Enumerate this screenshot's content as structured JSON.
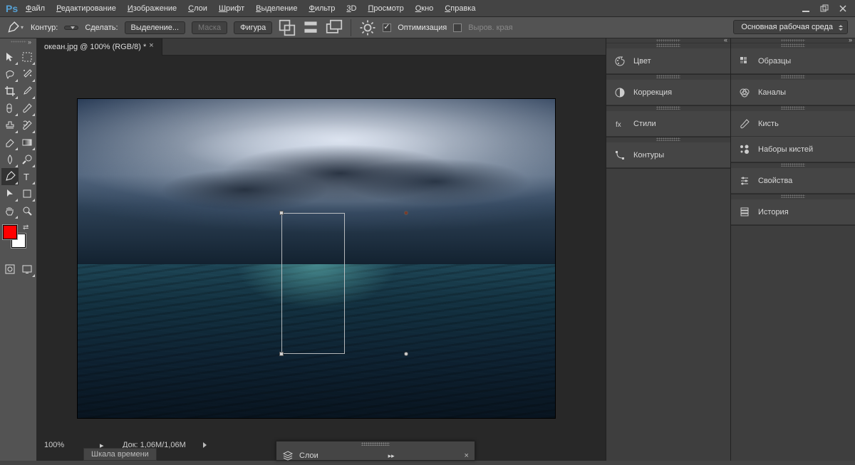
{
  "menubar": {
    "items": [
      "Файл",
      "Редактирование",
      "Изображение",
      "Слои",
      "Шрифт",
      "Выделение",
      "Фильтр",
      "3D",
      "Просмотр",
      "Окно",
      "Справка"
    ]
  },
  "options": {
    "contour_label": "Контур:",
    "make_label": "Сделать:",
    "selection_btn": "Выделение...",
    "mask_btn": "Маска",
    "shape_btn": "Фигура",
    "optimize_label": "Оптимизация",
    "align_edges_label": "Выров. края",
    "workspace": "Основная рабочая среда"
  },
  "document": {
    "tab_title": "океан.jpg @ 100% (RGB/8) *"
  },
  "status": {
    "zoom": "100%",
    "doc_info": "Док: 1,06M/1,06M"
  },
  "timeline": {
    "label": "Шкала времени"
  },
  "layers_panel": {
    "title": "Слои"
  },
  "panels_left": {
    "color": "Цвет",
    "correction": "Коррекция",
    "styles": "Стили",
    "contours": "Контуры"
  },
  "panels_right": {
    "swatches": "Образцы",
    "channels": "Каналы",
    "brush": "Кисть",
    "brush_sets": "Наборы кистей",
    "properties": "Свойства",
    "history": "История"
  },
  "colors": {
    "foreground": "#ff0000",
    "background": "#ffffff"
  }
}
